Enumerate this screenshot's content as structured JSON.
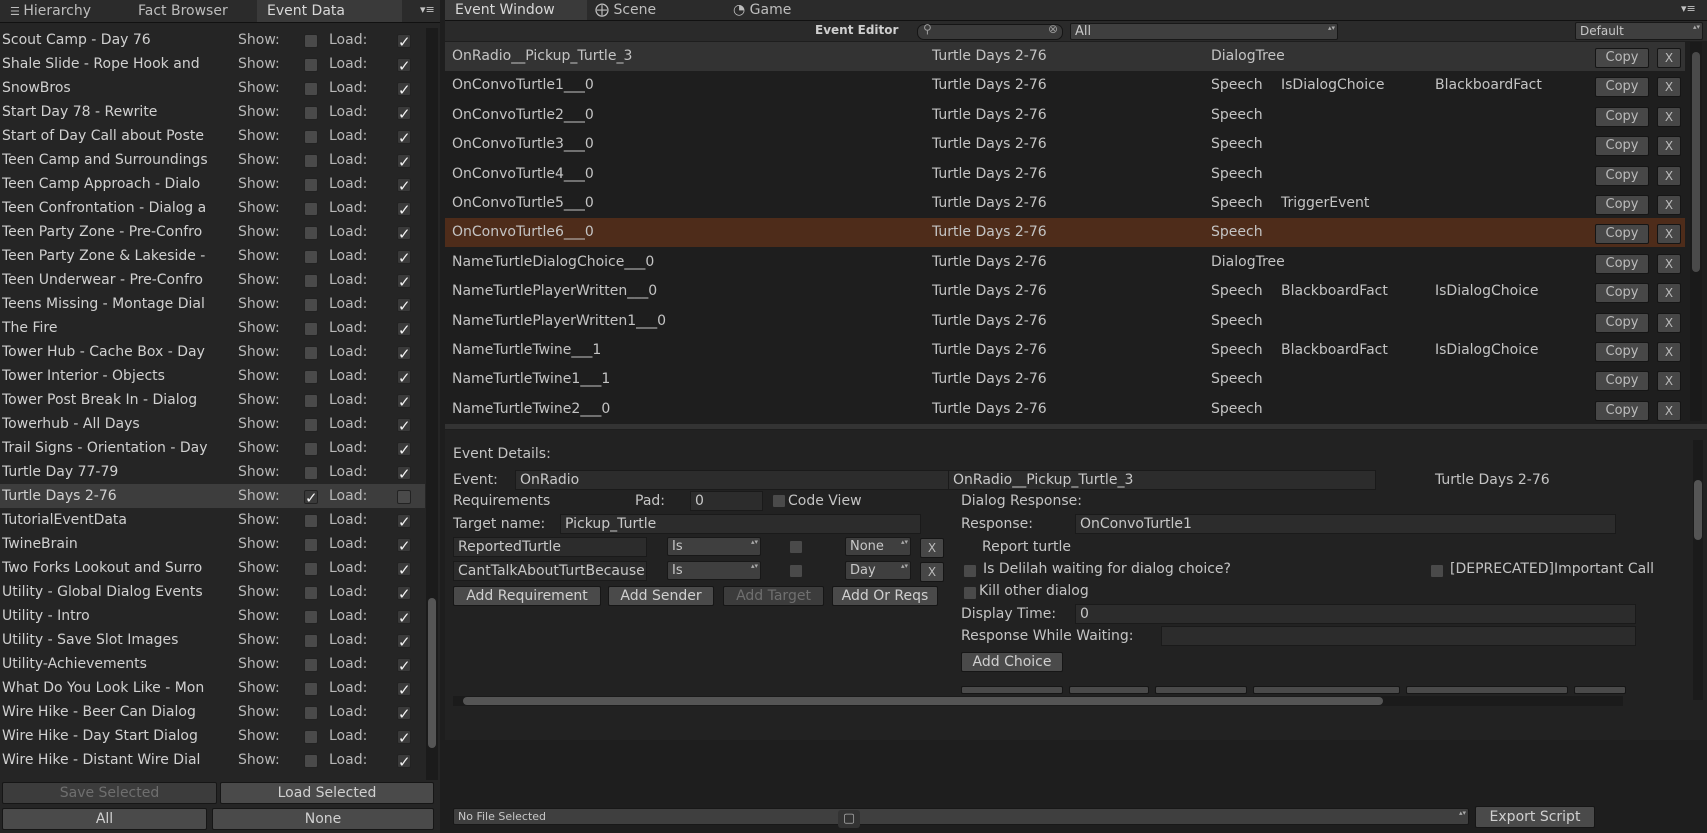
{
  "left": {
    "tabs": [
      "Hierarchy",
      "Fact Browser",
      "Event Data"
    ],
    "show_label": "Show:",
    "load_label": "Load:",
    "rows": [
      {
        "name": "Scout Camp - Day 76",
        "show": false,
        "load": true
      },
      {
        "name": "Shale Slide - Rope Hook and",
        "show": false,
        "load": true
      },
      {
        "name": "SnowBros",
        "show": false,
        "load": true
      },
      {
        "name": "Start Day 78 - Rewrite",
        "show": false,
        "load": true
      },
      {
        "name": "Start of Day Call about Poste",
        "show": false,
        "load": true
      },
      {
        "name": "Teen Camp and Surroundings",
        "show": false,
        "load": true
      },
      {
        "name": "Teen Camp Approach - Dialo",
        "show": false,
        "load": true
      },
      {
        "name": "Teen Confrontation - Dialog a",
        "show": false,
        "load": true
      },
      {
        "name": "Teen Party Zone - Pre-Confro",
        "show": false,
        "load": true
      },
      {
        "name": "Teen Party Zone & Lakeside -",
        "show": false,
        "load": true
      },
      {
        "name": "Teen Underwear - Pre-Confro",
        "show": false,
        "load": true
      },
      {
        "name": "Teens Missing - Montage Dial",
        "show": false,
        "load": true
      },
      {
        "name": "The Fire",
        "show": false,
        "load": true
      },
      {
        "name": "Tower Hub - Cache Box - Day",
        "show": false,
        "load": true
      },
      {
        "name": "Tower Interior - Objects",
        "show": false,
        "load": true
      },
      {
        "name": "Tower Post Break In - Dialog",
        "show": false,
        "load": true
      },
      {
        "name": "Towerhub - All Days",
        "show": false,
        "load": true
      },
      {
        "name": "Trail Signs - Orientation - Day",
        "show": false,
        "load": true
      },
      {
        "name": "Turtle Day 77-79",
        "show": false,
        "load": true
      },
      {
        "name": "Turtle Days 2-76",
        "show": true,
        "load": false,
        "selected": true
      },
      {
        "name": "TutorialEventData",
        "show": false,
        "load": true
      },
      {
        "name": "TwineBrain",
        "show": false,
        "load": true
      },
      {
        "name": "Two Forks Lookout and Surro",
        "show": false,
        "load": true
      },
      {
        "name": "Utility - Global Dialog Events",
        "show": false,
        "load": true
      },
      {
        "name": "Utility - Intro",
        "show": false,
        "load": true
      },
      {
        "name": "Utility - Save Slot Images",
        "show": false,
        "load": true
      },
      {
        "name": "Utility-Achievements",
        "show": false,
        "load": true
      },
      {
        "name": "What Do You Look Like - Mon",
        "show": false,
        "load": true
      },
      {
        "name": "Wire Hike - Beer Can Dialog",
        "show": false,
        "load": true
      },
      {
        "name": "Wire Hike - Day Start Dialog",
        "show": false,
        "load": true
      },
      {
        "name": "Wire Hike - Distant Wire Dial",
        "show": false,
        "load": true
      }
    ],
    "save_selected": "Save Selected",
    "load_selected": "Load Selected",
    "all": "All",
    "none": "None"
  },
  "right": {
    "tabs": [
      "Event Window",
      "Scene",
      "Game"
    ],
    "toolbar": {
      "title": "Event Editor",
      "filter": "All",
      "layout": "Default"
    },
    "copy_label": "Copy",
    "x_label": "X",
    "events": [
      {
        "name": "OnRadio__Pickup_Turtle_3",
        "file": "Turtle Days 2-76",
        "type": "DialogTree",
        "tag1": "",
        "tag2": ""
      },
      {
        "name": "OnConvoTurtle1___0",
        "file": "Turtle Days 2-76",
        "type": "Speech",
        "tag1": "IsDialogChoice",
        "tag2": "BlackboardFact"
      },
      {
        "name": "OnConvoTurtle2___0",
        "file": "Turtle Days 2-76",
        "type": "Speech",
        "tag1": "",
        "tag2": ""
      },
      {
        "name": "OnConvoTurtle3___0",
        "file": "Turtle Days 2-76",
        "type": "Speech",
        "tag1": "",
        "tag2": ""
      },
      {
        "name": "OnConvoTurtle4___0",
        "file": "Turtle Days 2-76",
        "type": "Speech",
        "tag1": "",
        "tag2": ""
      },
      {
        "name": "OnConvoTurtle5___0",
        "file": "Turtle Days 2-76",
        "type": "Speech",
        "tag1": "TriggerEvent",
        "tag2": ""
      },
      {
        "name": "OnConvoTurtle6___0",
        "file": "Turtle Days 2-76",
        "type": "Speech",
        "tag1": "",
        "tag2": ""
      },
      {
        "name": "NameTurtleDialogChoice___0",
        "file": "Turtle Days 2-76",
        "type": "DialogTree",
        "tag1": "",
        "tag2": ""
      },
      {
        "name": "NameTurtlePlayerWritten___0",
        "file": "Turtle Days 2-76",
        "type": "Speech",
        "tag1": "BlackboardFact",
        "tag2": "IsDialogChoice"
      },
      {
        "name": "NameTurtlePlayerWritten1___0",
        "file": "Turtle Days 2-76",
        "type": "Speech",
        "tag1": "",
        "tag2": ""
      },
      {
        "name": "NameTurtleTwine___1",
        "file": "Turtle Days 2-76",
        "type": "Speech",
        "tag1": "BlackboardFact",
        "tag2": "IsDialogChoice"
      },
      {
        "name": "NameTurtleTwine1___1",
        "file": "Turtle Days 2-76",
        "type": "Speech",
        "tag1": "",
        "tag2": ""
      },
      {
        "name": "NameTurtleTwine2___0",
        "file": "Turtle Days 2-76",
        "type": "Speech",
        "tag1": "",
        "tag2": ""
      }
    ],
    "details": {
      "header": "Event Details:",
      "event_label": "Event:",
      "event_value": "OnRadio",
      "event_name": "OnRadio__Pickup_Turtle_3",
      "event_file": "Turtle Days 2-76",
      "requirements_label": "Requirements",
      "pad_label": "Pad:",
      "pad_value": "0",
      "code_view": "Code View",
      "target_label": "Target name:",
      "target_value": "Pickup_Turtle",
      "req1": {
        "fact": "ReportedTurtle",
        "op": "Is",
        "value": "None"
      },
      "req2": {
        "fact": "CantTalkAboutTurtBecause",
        "op": "Is",
        "value": "Day"
      },
      "add_requirement": "Add Requirement",
      "add_sender": "Add Sender",
      "add_target": "Add Target",
      "add_or_reqs": "Add Or Reqs",
      "dialog_response": "Dialog Response:",
      "response_label": "Response:",
      "response_value": "OnConvoTurtle1",
      "response_text": "Report turtle",
      "delilah_waiting": "Is Delilah waiting for dialog choice?",
      "deprecated": "[DEPRECATED]Important Call",
      "kill_other": "Kill other dialog",
      "display_time_label": "Display Time:",
      "display_time_value": "0",
      "response_while_waiting": "Response While Waiting:",
      "add_choice": "Add Choice"
    },
    "bottom": {
      "file_selected": "No File Selected",
      "export": "Export Script"
    }
  }
}
